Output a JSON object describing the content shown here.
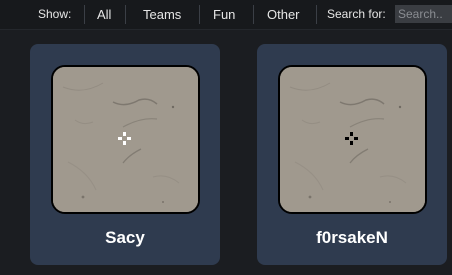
{
  "filter_bar": {
    "show_label": "Show:",
    "tabs": [
      {
        "label": "All"
      },
      {
        "label": "Teams"
      },
      {
        "label": "Fun"
      },
      {
        "label": "Other"
      }
    ],
    "search_label": "Search for:",
    "search_placeholder": "Search.."
  },
  "cards": [
    {
      "name": "Sacy",
      "crosshair_color": "#ffffff",
      "crosshair_icon": "crosshair-icon"
    },
    {
      "name": "f0rsakeN",
      "crosshair_color": "#000000",
      "crosshair_icon": "crosshair-icon"
    }
  ],
  "colors": {
    "background": "#1b1d21",
    "card": "#2f3b4f",
    "thumb_texture": "#9c968b"
  }
}
